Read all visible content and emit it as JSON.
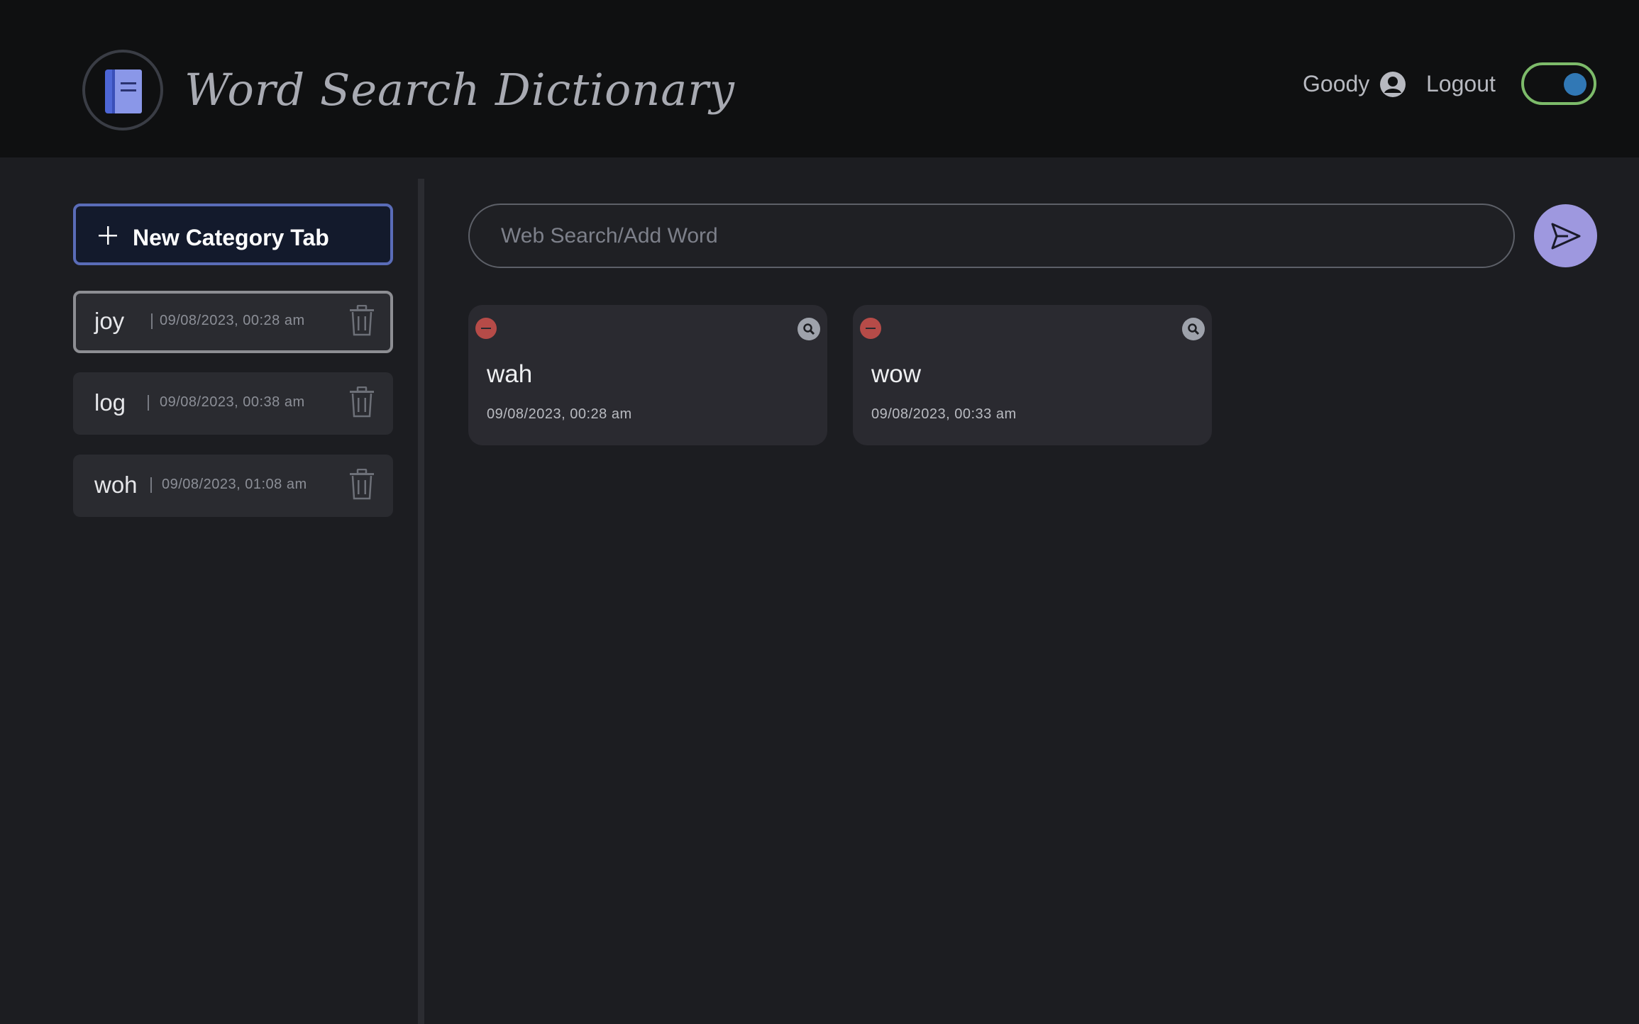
{
  "header": {
    "title": "Word Search Dictionary",
    "username": "Goody",
    "logout_label": "Logout",
    "dark_mode_on": true
  },
  "sidebar": {
    "new_tab_label": "New Category Tab",
    "categories": [
      {
        "name": "joy",
        "date": "09/08/2023, 00:28 am",
        "active": true
      },
      {
        "name": "log",
        "date": "09/08/2023, 00:38 am",
        "active": false
      },
      {
        "name": "woh",
        "date": "09/08/2023, 01:08 am",
        "active": false
      }
    ]
  },
  "search": {
    "placeholder": "Web Search/Add Word",
    "value": ""
  },
  "words": [
    {
      "word": "wah",
      "date": "09/08/2023, 00:28 am"
    },
    {
      "word": "wow",
      "date": "09/08/2023, 00:33 am"
    }
  ],
  "colors": {
    "header_bg": "#0f1011",
    "page_bg": "#1c1d21",
    "accent_purple": "#9e98df",
    "toggle_border": "#7dbb6a",
    "toggle_knob": "#3178b5",
    "remove_red": "#b64b48"
  },
  "icons": [
    "book-icon",
    "user-circle-icon",
    "plus-icon",
    "trash-icon",
    "send-icon",
    "minus-icon",
    "search-icon"
  ]
}
